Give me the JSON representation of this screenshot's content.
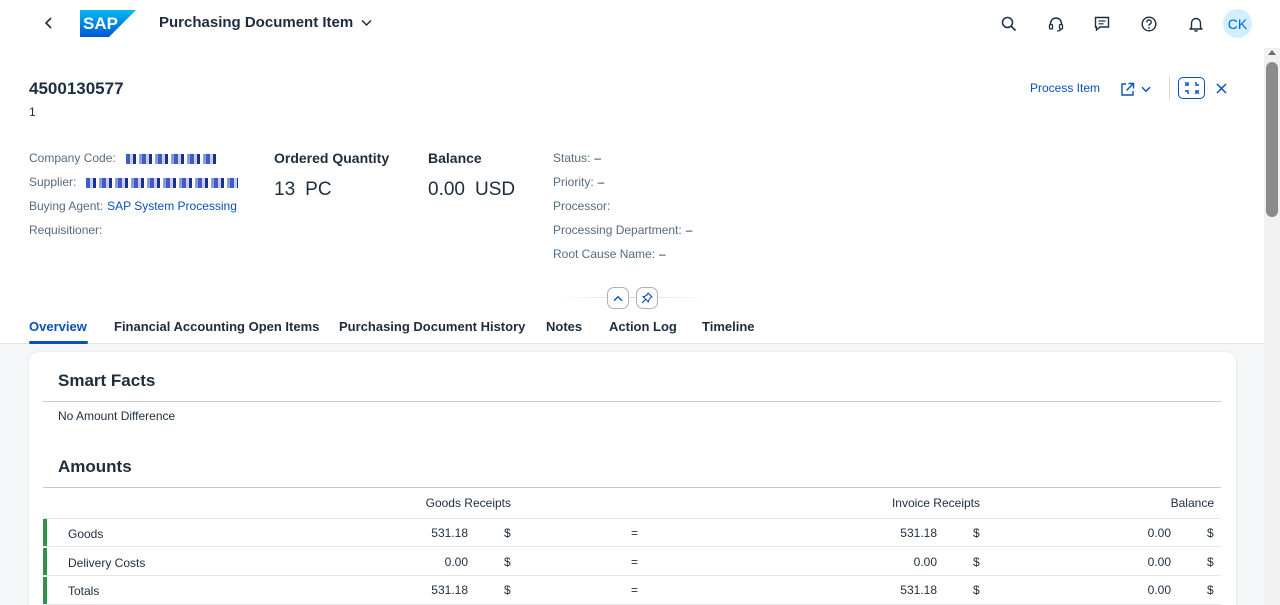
{
  "shell": {
    "logo_text": "SAP",
    "app_title": "Purchasing Document Item",
    "user_initials": "CK",
    "icons": [
      "back-icon",
      "search-icon",
      "headset-icon",
      "feedback-icon",
      "help-icon",
      "bell-icon"
    ]
  },
  "header": {
    "title": "4500130577",
    "subtitle": "1",
    "actions": {
      "process_item": "Process Item"
    },
    "attributes_left": [
      {
        "label": "Company Code:",
        "value": ""
      },
      {
        "label": "Supplier:",
        "value": ""
      },
      {
        "label": "Buying Agent:",
        "value": "SAP System Processing"
      },
      {
        "label": "Requisitioner:",
        "value": ""
      }
    ],
    "kpis": [
      {
        "label": "Ordered Quantity",
        "value": "13",
        "unit": "PC"
      },
      {
        "label": "Balance",
        "value": "0.00",
        "unit": "USD"
      }
    ],
    "attributes_right": [
      {
        "label": "Status:",
        "value": "–"
      },
      {
        "label": "Priority:",
        "value": "–"
      },
      {
        "label": "Processor:",
        "value": ""
      },
      {
        "label": "Processing Department:",
        "value": "–"
      },
      {
        "label": "Root Cause Name:",
        "value": "–"
      }
    ]
  },
  "tabs": [
    "Overview",
    "Financial Accounting Open Items",
    "Purchasing Document History",
    "Notes",
    "Action Log",
    "Timeline"
  ],
  "active_tab": "Overview",
  "smart_facts": {
    "title": "Smart Facts",
    "text": "No Amount Difference"
  },
  "amounts": {
    "title": "Amounts",
    "columns": {
      "goods_receipts": "Goods Receipts",
      "invoice_receipts": "Invoice Receipts",
      "balance": "Balance"
    },
    "rows": [
      {
        "label": "Goods",
        "gr": "531.18",
        "gr_cur": "$",
        "op": "=",
        "ir": "531.18",
        "ir_cur": "$",
        "bal": "0.00",
        "bal_cur": "$"
      },
      {
        "label": "Delivery Costs",
        "gr": "0.00",
        "gr_cur": "$",
        "op": "=",
        "ir": "0.00",
        "ir_cur": "$",
        "bal": "0.00",
        "bal_cur": "$"
      },
      {
        "label": "Totals",
        "gr": "531.18",
        "gr_cur": "$",
        "op": "=",
        "ir": "531.18",
        "ir_cur": "$",
        "bal": "0.00",
        "bal_cur": "$"
      }
    ]
  },
  "colors": {
    "brand_blue": "#0a51b8",
    "status_green": "#30914c",
    "avatar_bg": "#d1efff"
  }
}
